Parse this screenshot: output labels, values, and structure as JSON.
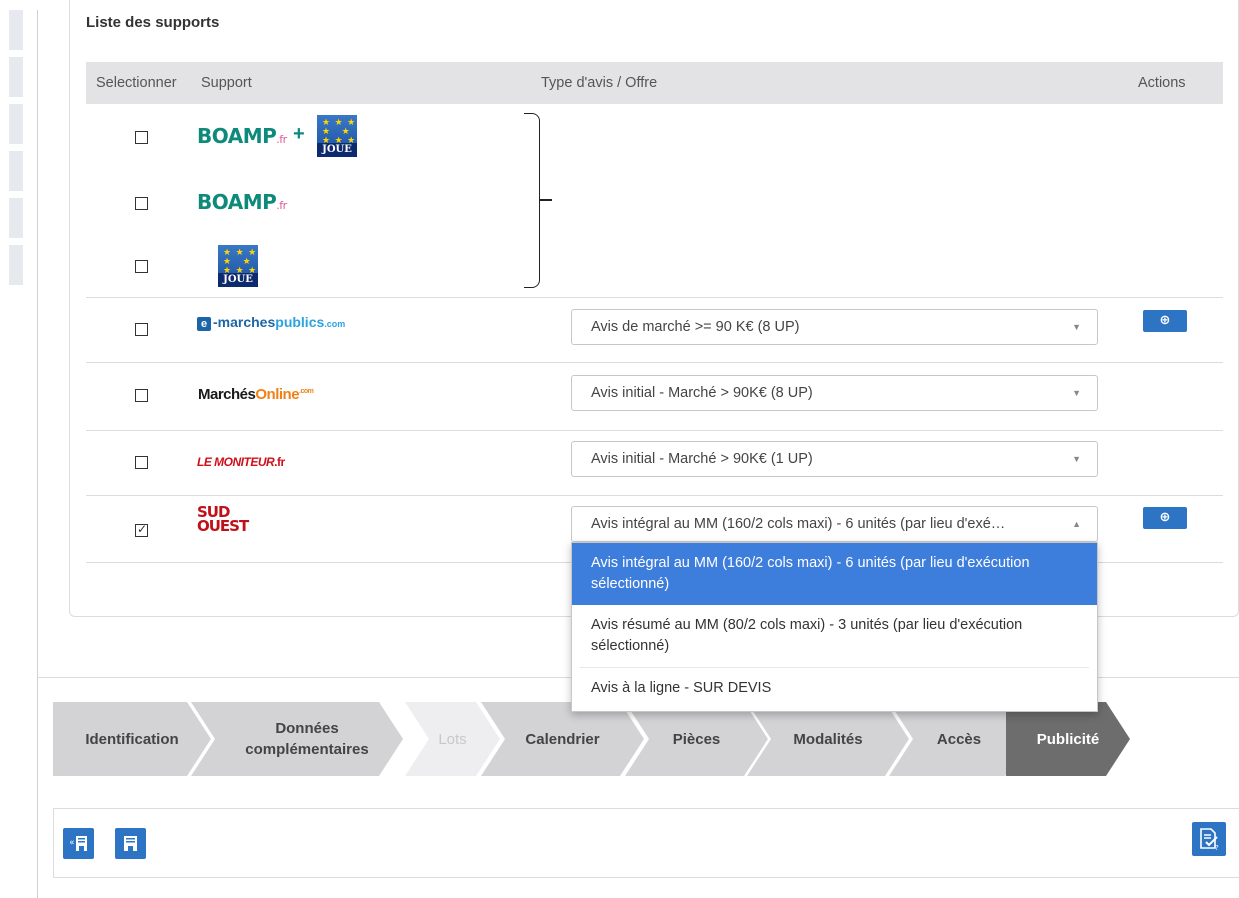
{
  "panel": {
    "title": "Liste des supports"
  },
  "table": {
    "headers": {
      "select": "Selectionner",
      "support": "Support",
      "type": "Type d'avis / Offre",
      "actions": "Actions"
    }
  },
  "logos": {
    "boamp": "BOAMP",
    "boamp_fr": ".fr",
    "plus": "+",
    "joue": "JOUE",
    "emp_e": "e",
    "emp_main": "-marches",
    "emp_pub": "publics",
    "emp_com": ".com",
    "mo_main": "Marchés",
    "mo_online": "Online",
    "mo_com": ".com",
    "lm_main": "LE MONITEUR",
    "lm_fr": ".fr",
    "so_line1": "SUD",
    "so_line2": "OUEST"
  },
  "rows": [
    {
      "id": "boamp-joue",
      "checked": false
    },
    {
      "id": "boamp",
      "checked": false
    },
    {
      "id": "joue",
      "checked": false
    },
    {
      "id": "e-marchespublics",
      "checked": false,
      "offer": "Avis de marché >= 90 K€ (8 UP)"
    },
    {
      "id": "marchesonline",
      "checked": false,
      "offer": "Avis initial - Marché > 90K€ (8 UP)"
    },
    {
      "id": "lemoniteur",
      "checked": false,
      "offer": "Avis initial - Marché > 90K€ (1 UP)"
    },
    {
      "id": "sudouest",
      "checked": true,
      "offer": "Avis intégral au MM (160/2 cols maxi) - 6 unités (par lieu d'exé…"
    }
  ],
  "dropdown": {
    "options": [
      "Avis intégral au MM (160/2 cols maxi) - 6 unités (par lieu d'exécution sélectionné)",
      "Avis résumé au MM (80/2 cols maxi) - 3 unités (par lieu d'exécution sélectionné)",
      "Avis à la ligne - SUR DEVIS"
    ],
    "selected_index": 0
  },
  "steps": [
    {
      "label": "Identification",
      "state": "done"
    },
    {
      "label": "Données complémentaires",
      "state": "done"
    },
    {
      "label": "Lots",
      "state": "disabled"
    },
    {
      "label": "Calendrier",
      "state": "done"
    },
    {
      "label": "Pièces",
      "state": "done"
    },
    {
      "label": "Modalités",
      "state": "done"
    },
    {
      "label": "Accès",
      "state": "done"
    },
    {
      "label": "Publicité",
      "state": "active"
    }
  ],
  "icons": {
    "zoom": "zoom-in-icon",
    "back_save": "back-save-icon",
    "save": "save-icon",
    "validate": "validate-document-icon"
  },
  "colors": {
    "accent": "#2d74c4",
    "selected_option": "#3d7ddb",
    "active_step": "#6d6d6d",
    "step": "#d3d3d5"
  }
}
